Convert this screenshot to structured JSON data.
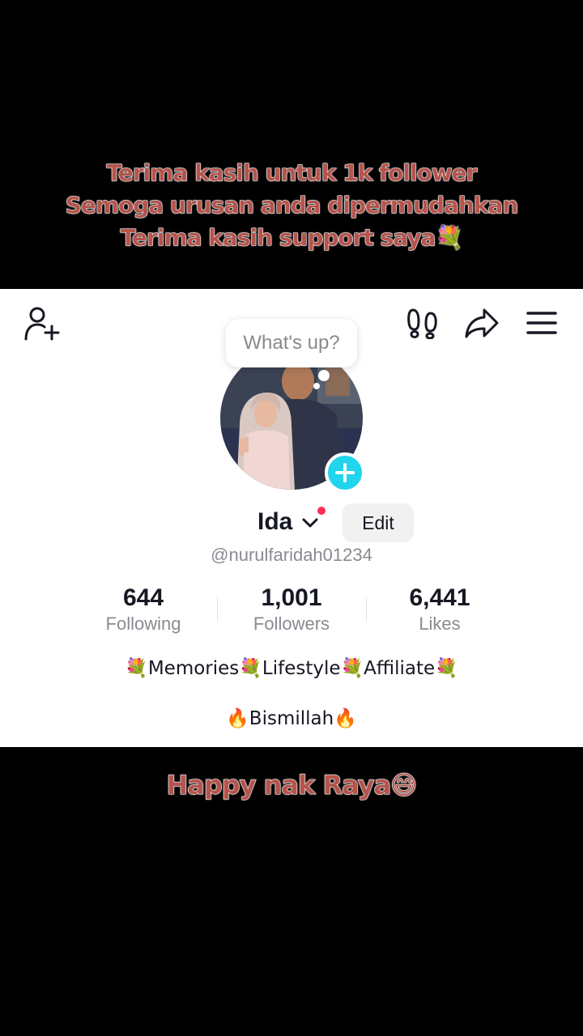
{
  "caption_top": {
    "line1": "Terima kasih untuk 1k follower",
    "line2": "Semoga urusan anda dipermudahkan",
    "line3": "Terima kasih support saya💐"
  },
  "caption_bottom": "Happy nak Raya😅",
  "header_icons": [
    "add-user-icon",
    "footprints-icon",
    "share-icon",
    "menu-icon"
  ],
  "status_bubble": "What's up?",
  "profile": {
    "name": "Ida",
    "edit_label": "Edit",
    "handle": "@nurulfaridah01234",
    "notification_color": "#fe2c55"
  },
  "stats": [
    {
      "value": "644",
      "label": "Following"
    },
    {
      "value": "1,001",
      "label": "Followers"
    },
    {
      "value": "6,441",
      "label": "Likes"
    }
  ],
  "bio": {
    "line1": "💐Memories💐Lifestyle💐Affiliate💐",
    "line2": "🔥Bismillah🔥"
  },
  "colors": {
    "caption": "#b5544c",
    "accent": "#20d5ec"
  }
}
